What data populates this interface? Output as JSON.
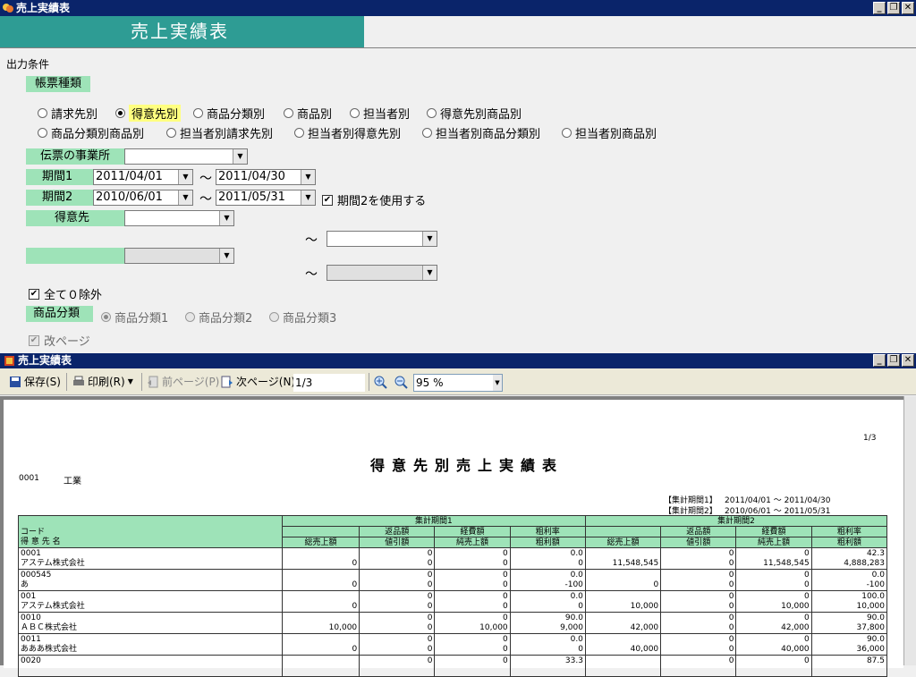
{
  "window": {
    "title": "売上実績表"
  },
  "banner": {
    "title": "売上実績表"
  },
  "conditions": {
    "section_label": "出力条件",
    "report_type_label": "帳票種類",
    "report_types": [
      {
        "label": "請求先別",
        "selected": false
      },
      {
        "label": "得意先別",
        "selected": true
      },
      {
        "label": "商品分類別",
        "selected": false
      },
      {
        "label": "商品別",
        "selected": false
      },
      {
        "label": "担当者別",
        "selected": false
      },
      {
        "label": "得意先別商品別",
        "selected": false
      },
      {
        "label": "商品分類別商品別",
        "selected": false
      },
      {
        "label": "担当者別請求先別",
        "selected": false
      },
      {
        "label": "担当者別得意先別",
        "selected": false
      },
      {
        "label": "担当者別商品分類別",
        "selected": false
      },
      {
        "label": "担当者別商品別",
        "selected": false
      }
    ],
    "office_label": "伝票の事業所",
    "office_value": "",
    "period1_label": "期間1",
    "period1_from": "2011/04/01",
    "period1_to": "2011/04/30",
    "period2_label": "期間2",
    "period2_from": "2010/06/01",
    "period2_to": "2011/05/31",
    "use_period2_label": "期間2を使用する",
    "use_period2_checked": true,
    "tilde": "～",
    "customer_label": "得意先",
    "customer_from": "",
    "customer_to": "",
    "blank_label": "",
    "exclude_zero_label": "全て０除外",
    "exclude_zero_checked": true,
    "product_class_label": "商品分類",
    "product_classes": [
      {
        "label": "商品分類1",
        "selected": true
      },
      {
        "label": "商品分類2",
        "selected": false
      },
      {
        "label": "商品分類3",
        "selected": false
      }
    ],
    "page_break_label": "改ページ",
    "page_break_checked": true
  },
  "preview": {
    "title": "売上実績表",
    "toolbar": {
      "save": "保存(S)",
      "print": "印刷(R)",
      "prev": "前ページ(P)",
      "next": "次ページ(N)",
      "page": "1/3",
      "zoom": "95 %"
    }
  },
  "report": {
    "page_no": "1/3",
    "title": "得意先別売上実績表",
    "company_code": "0001",
    "company_name": "工業",
    "period1_label": "【集計期間1】",
    "period1_range": "2011/04/01 ～ 2011/04/30",
    "period2_label": "【集計期間2】",
    "period2_range": "2010/06/01 ～ 2011/05/31",
    "header": {
      "code": "コード",
      "name": "得 意 先 名",
      "group1": "集計期間1",
      "group2": "集計期間2",
      "returns": "返品額",
      "expenses": "経費額",
      "margin_rate": "粗利率",
      "gross_sales": "総売上額",
      "discount": "値引額",
      "net_sales": "純売上額",
      "margin_amount": "粗利額"
    },
    "rows": [
      {
        "code": "0001",
        "name": "アステム株式会社",
        "p1": {
          "returns": "0",
          "expenses": "0",
          "rate": "0.0",
          "gross": "0",
          "discount": "0",
          "net": "0",
          "margin": "0"
        },
        "p2": {
          "returns": "0",
          "expenses": "0",
          "rate": "42.3",
          "gross": "11,548,545",
          "discount": "0",
          "net": "11,548,545",
          "margin": "4,888,283"
        }
      },
      {
        "code": "000545",
        "name": "あ",
        "p1": {
          "returns": "0",
          "expenses": "0",
          "rate": "0.0",
          "gross": "0",
          "discount": "0",
          "net": "0",
          "margin": "-100"
        },
        "p2": {
          "returns": "0",
          "expenses": "0",
          "rate": "0.0",
          "gross": "0",
          "discount": "0",
          "net": "0",
          "margin": "-100"
        }
      },
      {
        "code": "001",
        "name": "アステム株式会社",
        "p1": {
          "returns": "0",
          "expenses": "0",
          "rate": "0.0",
          "gross": "0",
          "discount": "0",
          "net": "0",
          "margin": "0"
        },
        "p2": {
          "returns": "0",
          "expenses": "0",
          "rate": "100.0",
          "gross": "10,000",
          "discount": "0",
          "net": "10,000",
          "margin": "10,000"
        }
      },
      {
        "code": "0010",
        "name": "ＡＢＣ株式会社",
        "p1": {
          "returns": "0",
          "expenses": "0",
          "rate": "90.0",
          "gross": "10,000",
          "discount": "0",
          "net": "10,000",
          "margin": "9,000"
        },
        "p2": {
          "returns": "0",
          "expenses": "0",
          "rate": "90.0",
          "gross": "42,000",
          "discount": "0",
          "net": "42,000",
          "margin": "37,800"
        }
      },
      {
        "code": "0011",
        "name": "あああ株式会社",
        "p1": {
          "returns": "0",
          "expenses": "0",
          "rate": "0.0",
          "gross": "0",
          "discount": "0",
          "net": "0",
          "margin": "0"
        },
        "p2": {
          "returns": "0",
          "expenses": "0",
          "rate": "90.0",
          "gross": "40,000",
          "discount": "0",
          "net": "40,000",
          "margin": "36,000"
        }
      },
      {
        "code": "0020",
        "name": "",
        "p1": {
          "returns": "0",
          "expenses": "0",
          "rate": "33.3",
          "gross": "",
          "discount": "",
          "net": "",
          "margin": ""
        },
        "p2": {
          "returns": "0",
          "expenses": "0",
          "rate": "87.5",
          "gross": "",
          "discount": "",
          "net": "",
          "margin": ""
        }
      }
    ]
  },
  "colors": {
    "titlebar": "#0a246a",
    "banner": "#2e9c94",
    "label_bg": "#9ee3b8",
    "highlight": "#ffff80"
  }
}
